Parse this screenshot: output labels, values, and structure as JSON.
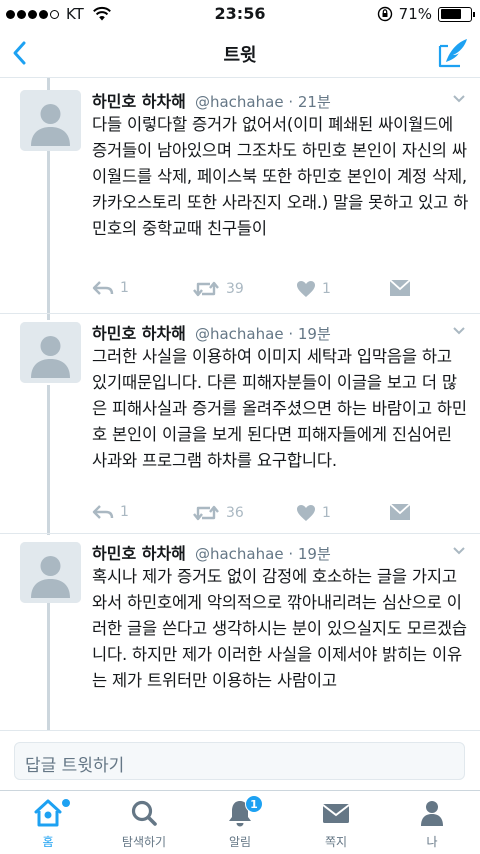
{
  "status_bar": {
    "carrier": "KT",
    "time": "23:56",
    "battery": "71%",
    "battery_level": 0.71
  },
  "nav": {
    "title": "트윗"
  },
  "tweets": [
    {
      "name": "하민호 하차해",
      "handle": "@hachahae",
      "time": "21분",
      "text": "다들 이렇다할 증거가 없어서(이미 폐쇄된 싸이월드에 증거들이 남아있으며 그조차도 하민호 본인이 자신의 싸이월드를 삭제, 페이스북 또한 하민호 본인이 계정 삭제, 카카오스토리 또한 사라진지 오래.) 말을 못하고 있고 하민호의 중학교때 친구들이",
      "replies": "1",
      "retweets": "39",
      "likes": "1"
    },
    {
      "name": "하민호 하차해",
      "handle": "@hachahae",
      "time": "19분",
      "text": "그러한 사실을 이용하여 이미지 세탁과 입막음을 하고 있기때문입니다. 다른 피해자분들이 이글을 보고 더 많은 피해사실과 증거를 올려주셨으면 하는 바람이고 하민호 본인이 이글을 보게 된다면 피해자들에게 진심어린 사과와 프로그램 하차를 요구합니다.",
      "replies": "1",
      "retweets": "36",
      "likes": "1"
    },
    {
      "name": "하민호 하차해",
      "handle": "@hachahae",
      "time": "19분",
      "text": "혹시나 제가 증거도 없이 감정에 호소하는 글을 가지고와서 하민호에게 악의적으로 깎아내리려는 심산으로 이러한 글을 쓴다고 생각하시는 분이 있으실지도 모르겠습니다. 하지만 제가 이러한 사실을 이제서야 밝히는 이유는 제가 트위터만 이용하는 사람이고"
    }
  ],
  "reply": {
    "placeholder": "답글 트윗하기"
  },
  "tabbar": {
    "home": "홈",
    "explore": "탐색하기",
    "notifications": "알림",
    "notifications_badge": "1",
    "messages": "쪽지",
    "me": "나"
  },
  "colors": {
    "accent": "#1da1f2",
    "muted": "#657786",
    "icon_gray": "#aab8c2"
  }
}
